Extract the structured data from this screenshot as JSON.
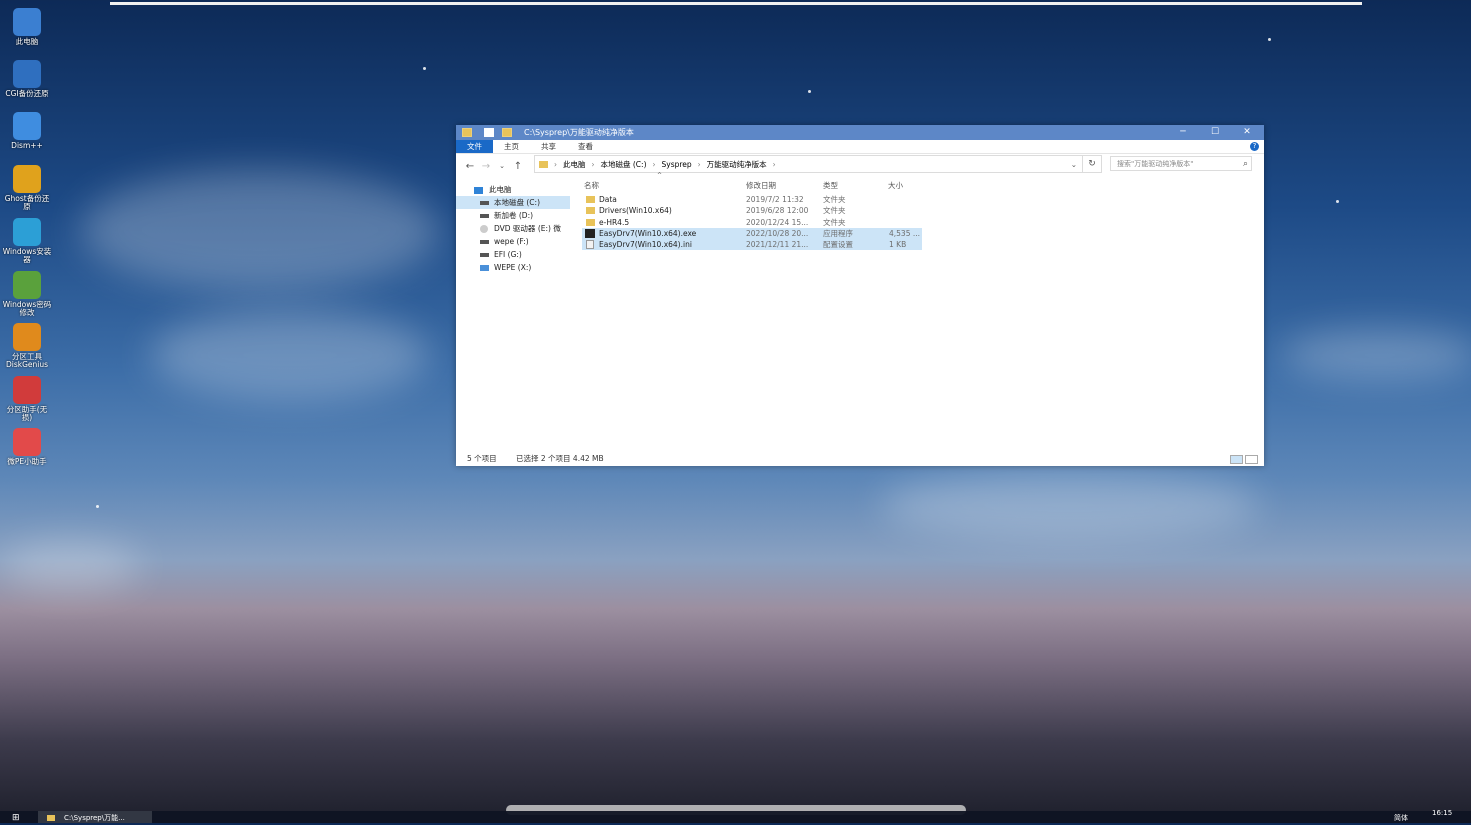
{
  "desktop": {
    "icons": [
      {
        "label": "此电脑",
        "icon": "computer-icon",
        "color": "#3b7fd1"
      },
      {
        "label": "CGI备份还原",
        "icon": "backup-icon",
        "color": "#2f6fbf"
      },
      {
        "label": "Dism++",
        "icon": "gears-icon",
        "color": "#3f8de0"
      },
      {
        "label": "Ghost备份还原",
        "icon": "ghost-icon",
        "color": "#e0a21c"
      },
      {
        "label": "Windows安装器",
        "icon": "installer-icon",
        "color": "#2c9fd6"
      },
      {
        "label": "Windows密码修改",
        "icon": "lock-icon",
        "color": "#5aa13c"
      },
      {
        "label": "分区工具DiskGenius",
        "icon": "diskgenius-icon",
        "color": "#e08a1c"
      },
      {
        "label": "分区助手(无损)",
        "icon": "partition-assistant-icon",
        "color": "#d13b3b"
      },
      {
        "label": "微PE小助手",
        "icon": "lifebuoy-icon",
        "color": "#e24a4a"
      }
    ]
  },
  "explorer": {
    "title": "C:\\Sysprep\\万能驱动纯净版本",
    "window_controls": {
      "minimize": "─",
      "maximize": "☐",
      "close": "✕"
    },
    "ribbon_tabs": [
      "文件",
      "主页",
      "共享",
      "查看"
    ],
    "ribbon_help": "?",
    "breadcrumb": [
      "此电脑",
      "本地磁盘 (C:)",
      "Sysprep",
      "万能驱动纯净版本"
    ],
    "search_placeholder": "搜索\"万能驱动纯净版本\"",
    "nav_tree": [
      {
        "label": "此电脑",
        "type": "pc",
        "indent": false,
        "selected": false
      },
      {
        "label": "本地磁盘 (C:)",
        "type": "drive",
        "indent": true,
        "selected": true
      },
      {
        "label": "新加卷 (D:)",
        "type": "drive",
        "indent": true,
        "selected": false
      },
      {
        "label": "DVD 驱动器 (E:) 微",
        "type": "dvd",
        "indent": true,
        "selected": false
      },
      {
        "label": "wepe (F:)",
        "type": "drive",
        "indent": true,
        "selected": false
      },
      {
        "label": "EFI (G:)",
        "type": "drive",
        "indent": true,
        "selected": false
      },
      {
        "label": "WEPE (X:)",
        "type": "net",
        "indent": true,
        "selected": false
      }
    ],
    "columns": {
      "name": "名称",
      "date": "修改日期",
      "type": "类型",
      "size": "大小"
    },
    "files": [
      {
        "name": "Data",
        "date": "2019/7/2 11:32",
        "type": "文件夹",
        "size": "",
        "kind": "folder",
        "selected": false
      },
      {
        "name": "Drivers(Win10.x64)",
        "date": "2019/6/28 12:00",
        "type": "文件夹",
        "size": "",
        "kind": "folder",
        "selected": false
      },
      {
        "name": "e-HR4.5",
        "date": "2020/12/24 15...",
        "type": "文件夹",
        "size": "",
        "kind": "folder",
        "selected": false
      },
      {
        "name": "EasyDrv7(Win10.x64).exe",
        "date": "2022/10/28 20...",
        "type": "应用程序",
        "size": "4,535 ...",
        "kind": "exe",
        "selected": true
      },
      {
        "name": "EasyDrv7(Win10.x64).ini",
        "date": "2021/12/11 21...",
        "type": "配置设置",
        "size": "1 KB",
        "kind": "ini",
        "selected": true
      }
    ],
    "status": {
      "count": "5 个项目",
      "selection": "已选择 2 个项目  4.42 MB"
    }
  },
  "taskbar": {
    "start_glyph": "⊞",
    "app_label": "C:\\Sysprep\\万能...",
    "ime": "简体",
    "time": "16:15"
  }
}
